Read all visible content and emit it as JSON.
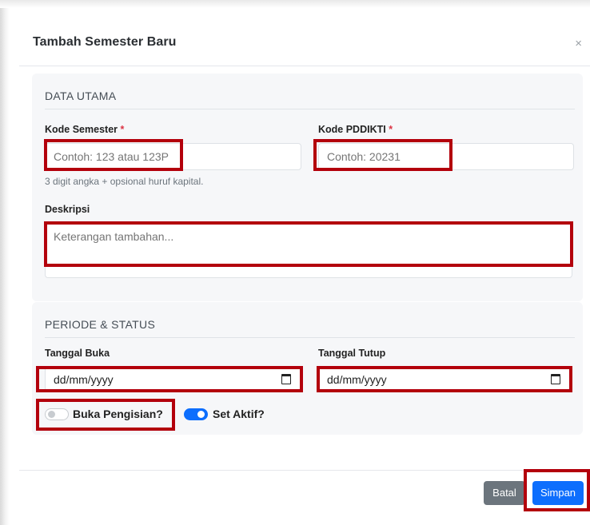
{
  "modal": {
    "title": "Tambah Semester Baru",
    "close_label": "×"
  },
  "section_main": {
    "title": "DATA UTAMA",
    "kode_semester": {
      "label": "Kode Semester",
      "required_mark": "*",
      "value": "",
      "placeholder": "Contoh: 123 atau 123P",
      "hint": "3 digit angka + opsional huruf kapital."
    },
    "kode_pddikti": {
      "label": "Kode PDDIKTI",
      "required_mark": "*",
      "value": "",
      "placeholder": "Contoh: 20231"
    },
    "deskripsi": {
      "label": "Deskripsi",
      "value": "",
      "placeholder": "Keterangan tambahan..."
    }
  },
  "section_period": {
    "title": "PERIODE & STATUS",
    "tanggal_buka": {
      "label": "Tanggal Buka",
      "display": "dd/mm/yyyy",
      "icon": "calendar-icon"
    },
    "tanggal_tutup": {
      "label": "Tanggal Tutup",
      "display": "dd/mm/yyyy",
      "icon": "calendar-icon"
    },
    "buka_pengisian": {
      "label": "Buka Pengisian?",
      "checked": false
    },
    "set_aktif": {
      "label": "Set Aktif?",
      "checked": true
    }
  },
  "footer": {
    "cancel_label": "Batal",
    "save_label": "Simpan"
  },
  "colors": {
    "primary": "#0d6efd",
    "secondary": "#6c757d",
    "required": "#dc3545",
    "highlight": "#b3000c"
  }
}
